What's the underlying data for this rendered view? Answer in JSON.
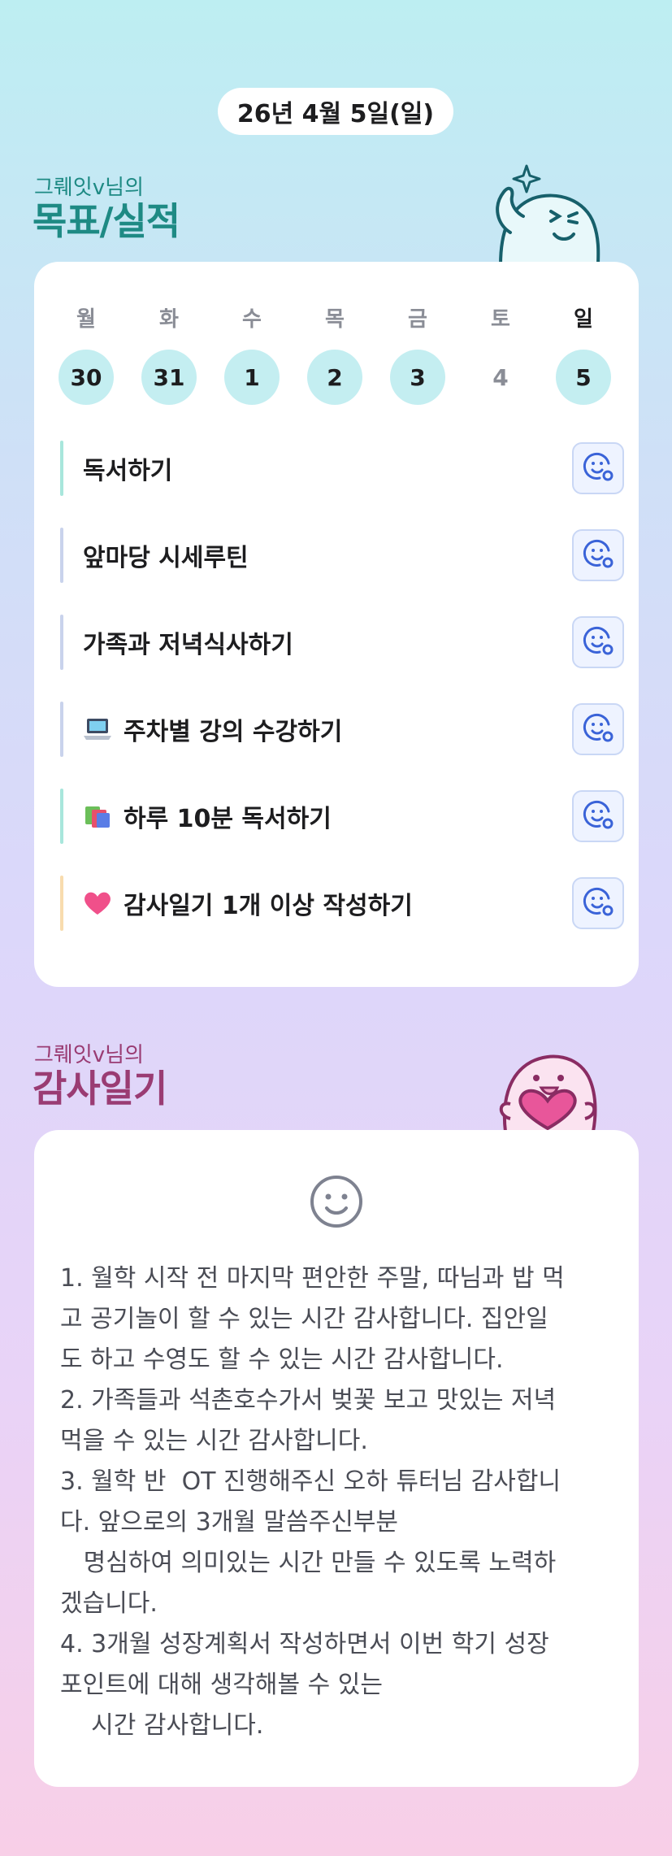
{
  "header": {
    "date": "26년 4월 5일(일)"
  },
  "goals_section": {
    "owner": "그뤠잇v님의",
    "title": "목표/실적"
  },
  "week": {
    "days": [
      {
        "label": "월",
        "num": "30",
        "done": true
      },
      {
        "label": "화",
        "num": "31",
        "done": true
      },
      {
        "label": "수",
        "num": "1",
        "done": true
      },
      {
        "label": "목",
        "num": "2",
        "done": true
      },
      {
        "label": "금",
        "num": "3",
        "done": true
      },
      {
        "label": "토",
        "num": "4",
        "done": false
      },
      {
        "label": "일",
        "num": "5",
        "done": true
      }
    ]
  },
  "goals": [
    {
      "label": "독서하기",
      "emoji": "",
      "bar_color": "#a8e6dc"
    },
    {
      "label": "앞마당 시세루틴",
      "emoji": "",
      "bar_color": "#c9d3ec"
    },
    {
      "label": "가족과 저녁식사하기",
      "emoji": "",
      "bar_color": "#c9d3ec"
    },
    {
      "label": "주차별 강의 수강하기",
      "emoji": "laptop-icon",
      "bar_color": "#c9d3ec"
    },
    {
      "label": "하루 10분 독서하기",
      "emoji": "books-icon",
      "bar_color": "#a8e6dc"
    },
    {
      "label": "감사일기 1개 이상 작성하기",
      "emoji": "heart-icon",
      "bar_color": "#f8dcae"
    }
  ],
  "diary_section": {
    "owner": "그뤠잇v님의",
    "title": "감사일기"
  },
  "diary": {
    "face_icon": "smile-face-icon",
    "text": "1. 월학 시작 전 마지막 편안한 주말, 따님과 밥 먹\n고 공기놀이 할 수 있는 시간 감사합니다. 집안일\n도 하고 수영도 할 수 있는 시간 감사합니다.\n2. 가족들과 석촌호수가서 벚꽃 보고 맛있는 저녁\n먹을 수 있는 시간 감사합니다.\n3. 월학 반  OT 진행해주신 오하 튜터님 감사합니\n다. 앞으로의 3개월 말씀주신부분\n   명심하여 의미있는 시간 만들 수 있도록 노력하\n겠습니다.\n4. 3개월 성장계획서 작성하면서 이번 학기 성장\n포인트에 대해 생각해볼 수 있는\n    시간 감사합니다."
  },
  "colors": {
    "goals_accent": "#1e8a84",
    "diary_accent": "#9a3c73",
    "day_done": "#c4eef1",
    "stamp_icon": "#3a63d8"
  }
}
